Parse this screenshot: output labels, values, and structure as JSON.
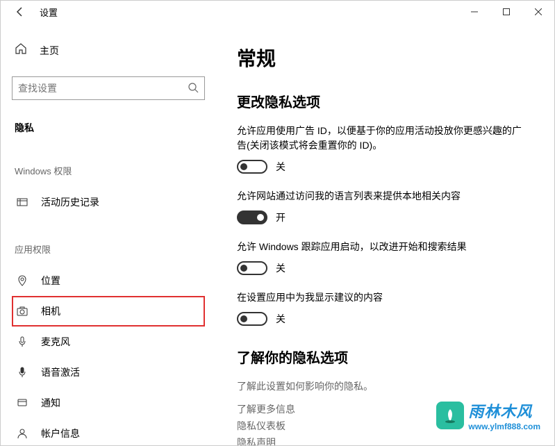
{
  "window": {
    "title": "设置"
  },
  "sidebar": {
    "home_label": "主页",
    "search_placeholder": "查找设置",
    "category_label": "隐私",
    "group1_label": "Windows 权限",
    "group2_label": "应用权限",
    "items": {
      "activity": "活动历史记录",
      "location": "位置",
      "camera": "相机",
      "microphone": "麦克风",
      "voice": "语音激活",
      "notifications": "通知",
      "account": "帐户信息"
    }
  },
  "main": {
    "page_title": "常规",
    "section1_title": "更改隐私选项",
    "options": [
      {
        "desc": "允许应用使用广告 ID，以便基于你的应用活动投放你更感兴趣的广告(关闭该模式将会重置你的 ID)。",
        "state_label": "关",
        "on": false
      },
      {
        "desc": "允许网站通过访问我的语言列表来提供本地相关内容",
        "state_label": "开",
        "on": true
      },
      {
        "desc": "允许 Windows 跟踪应用启动，以改进开始和搜索结果",
        "state_label": "关",
        "on": false
      },
      {
        "desc": "在设置应用中为我显示建议的内容",
        "state_label": "关",
        "on": false
      }
    ],
    "section2_title": "了解你的隐私选项",
    "info_desc": "了解此设置如何影响你的隐私。",
    "links": [
      "了解更多信息",
      "隐私仪表板",
      "隐私声明"
    ]
  },
  "watermark": {
    "title": "雨林木风",
    "url": "www.ylmf888.com"
  }
}
